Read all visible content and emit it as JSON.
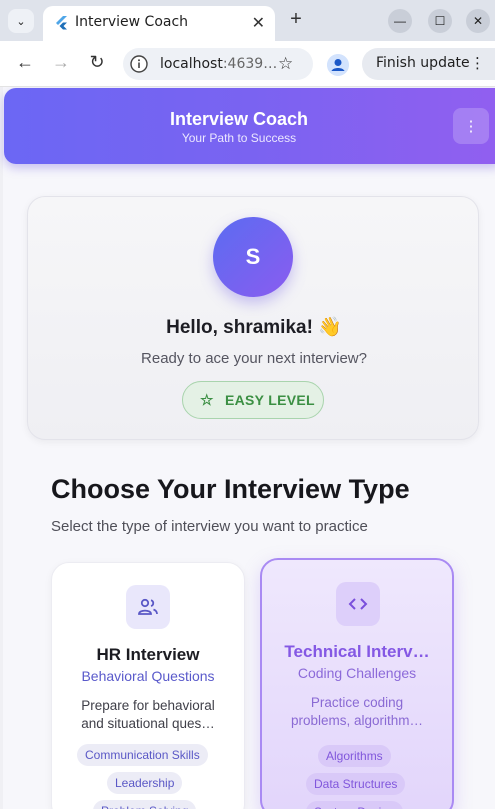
{
  "browser": {
    "tab_title": "Interview Coach",
    "url_host": "localhost",
    "url_rest": ":4639…",
    "update_button": "Finish update"
  },
  "appbar": {
    "title": "Interview Coach",
    "subtitle": "Your Path to Success"
  },
  "profile": {
    "avatar_initial": "S",
    "greeting": "Hello, shramika! 👋",
    "prompt": "Ready to ace your next interview?",
    "level": "EASY LEVEL"
  },
  "section": {
    "heading": "Choose Your Interview Type",
    "subheading": "Select the type of interview you want to practice"
  },
  "interview_types": [
    {
      "title": "HR Interview",
      "subtitle": "Behavioral Questions",
      "description_lines": [
        "Prepare for behavioral",
        "and situational ques…"
      ],
      "tags": [
        "Communication Skills",
        "Leadership",
        "Problem Solving"
      ],
      "icon": "people-icon"
    },
    {
      "title": "Technical Interv…",
      "subtitle": "Coding Challenges",
      "description_lines": [
        "Practice coding",
        "problems, algorithm…"
      ],
      "tags": [
        "Algorithms",
        "Data Structures",
        "System Design"
      ],
      "icon": "code-icon",
      "selected": true
    }
  ],
  "colors": {
    "brand_gradient_start": "#6b67f4",
    "brand_gradient_end": "#915ff0",
    "level_green": "#3b8f43",
    "selected_accent": "#8458e4"
  }
}
